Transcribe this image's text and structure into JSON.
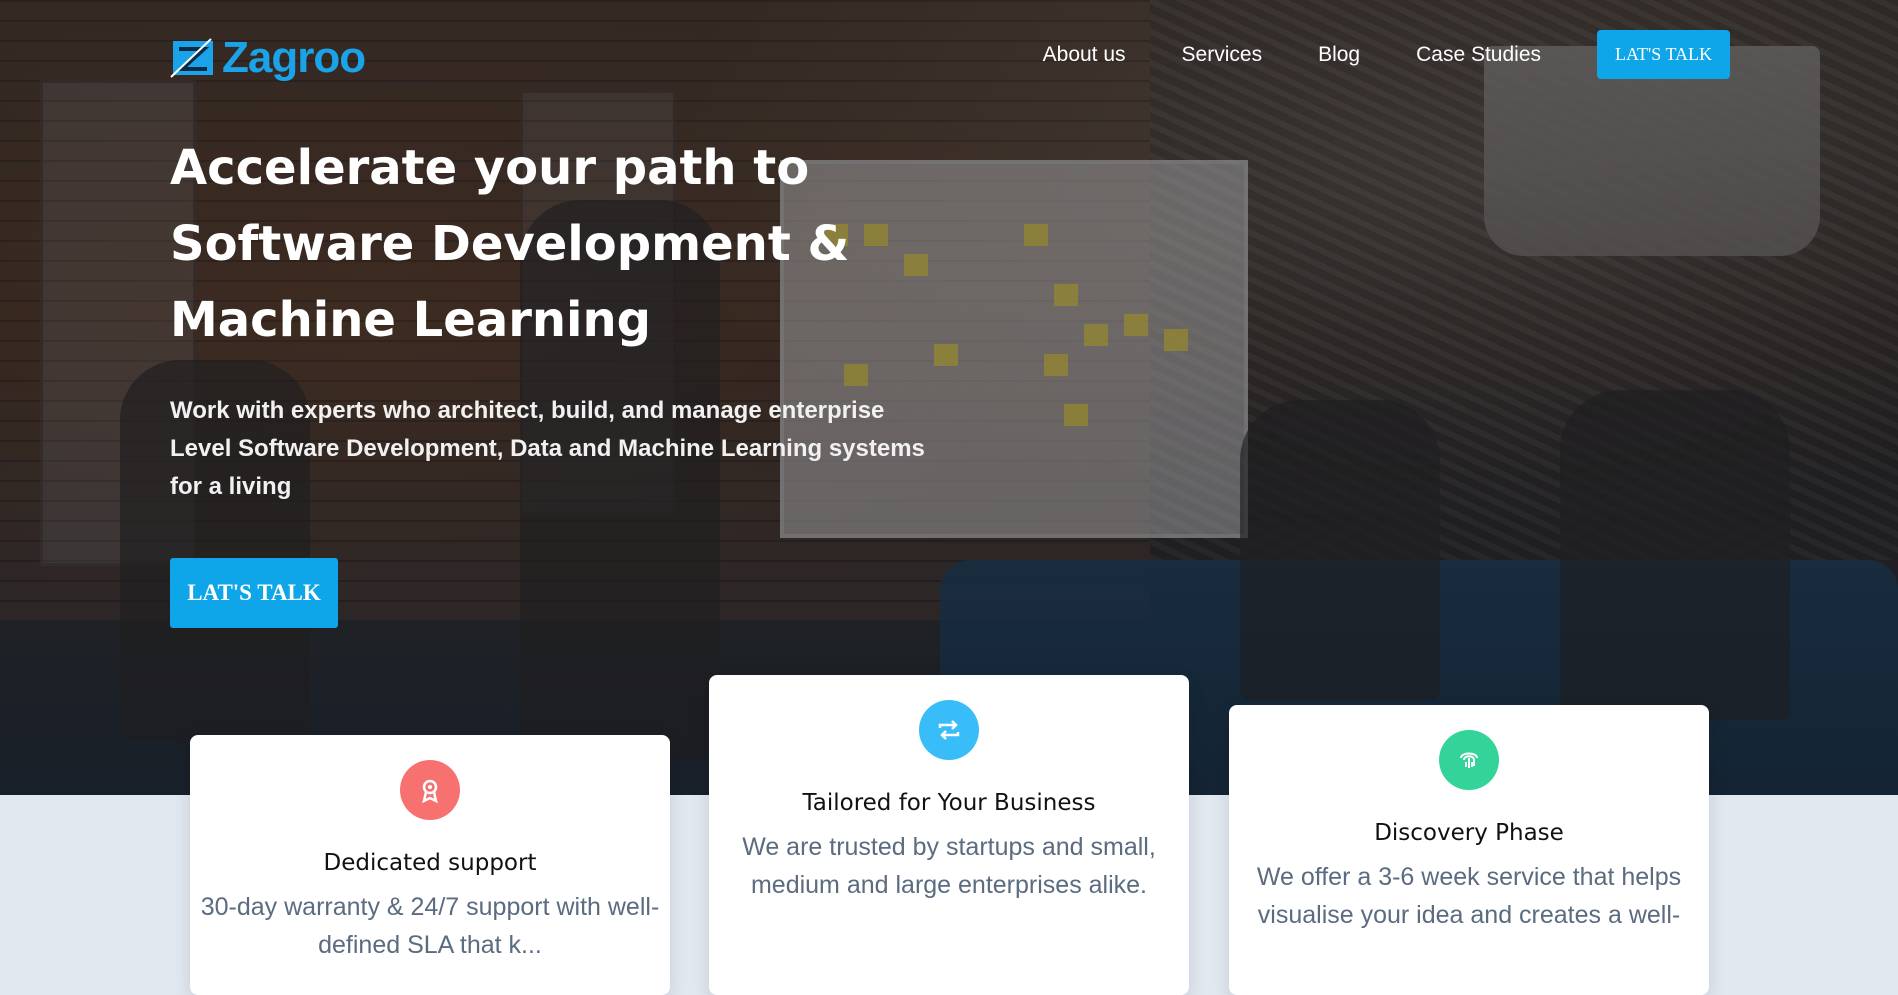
{
  "brand": {
    "name": "Zagroo",
    "color": "#1aa3e8"
  },
  "nav": {
    "items": [
      "About us",
      "Services",
      "Blog",
      "Case Studies"
    ],
    "cta_label": "LAT'S TALK"
  },
  "hero": {
    "headline": "Accelerate your path to Software Development & Machine Learning",
    "subtext": "Work with experts who architect, build, and manage enterprise Level Software Development, Data and Machine Learning systems for a living",
    "cta_label": "LAT'S TALK"
  },
  "features": [
    {
      "icon": "award-icon",
      "color": "#f87171",
      "title": "Dedicated support",
      "text": "30-day warranty & 24/7 support with well-defined SLA that k..."
    },
    {
      "icon": "repeat-icon",
      "color": "#38bdf8",
      "title": "Tailored for Your Business",
      "text": "We are trusted by startups and small, medium and large enterprises alike."
    },
    {
      "icon": "fingerprint-icon",
      "color": "#34d399",
      "title": "Discovery Phase",
      "text": "We offer a 3-6 week service that helps visualise your idea and creates a well-"
    }
  ],
  "colors": {
    "accent": "#0ea5e9",
    "page_bg": "#e2e8f0"
  }
}
